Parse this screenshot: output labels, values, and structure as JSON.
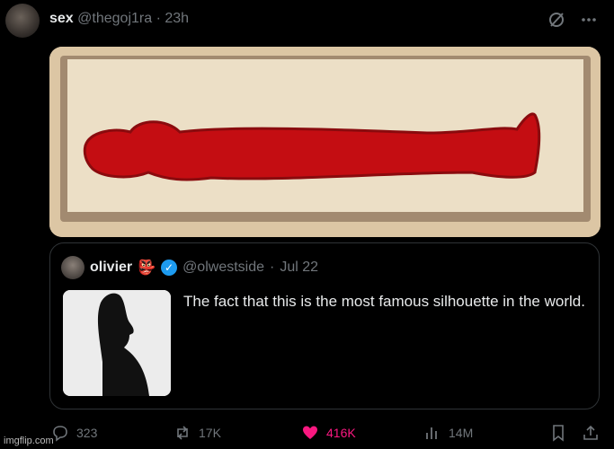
{
  "post": {
    "display_name": "sex",
    "handle": "@thegoj1ra",
    "separator": "·",
    "time": "23h",
    "icons": [
      "grok-icon",
      "more-icon"
    ]
  },
  "quote": {
    "display_name": "olivier",
    "emoji": "👺",
    "handle": "@olwestside",
    "separator": "·",
    "date": "Jul 22",
    "text": "The fact that this is the most famous silhouette in the world."
  },
  "actions": {
    "replies": "323",
    "reposts": "17K",
    "likes": "416K",
    "views": "14M"
  },
  "watermark": "imgflip.com",
  "colors": {
    "background": "#000000",
    "like": "#f91880",
    "verified": "#1d9bf0",
    "muted": "#71767b"
  }
}
